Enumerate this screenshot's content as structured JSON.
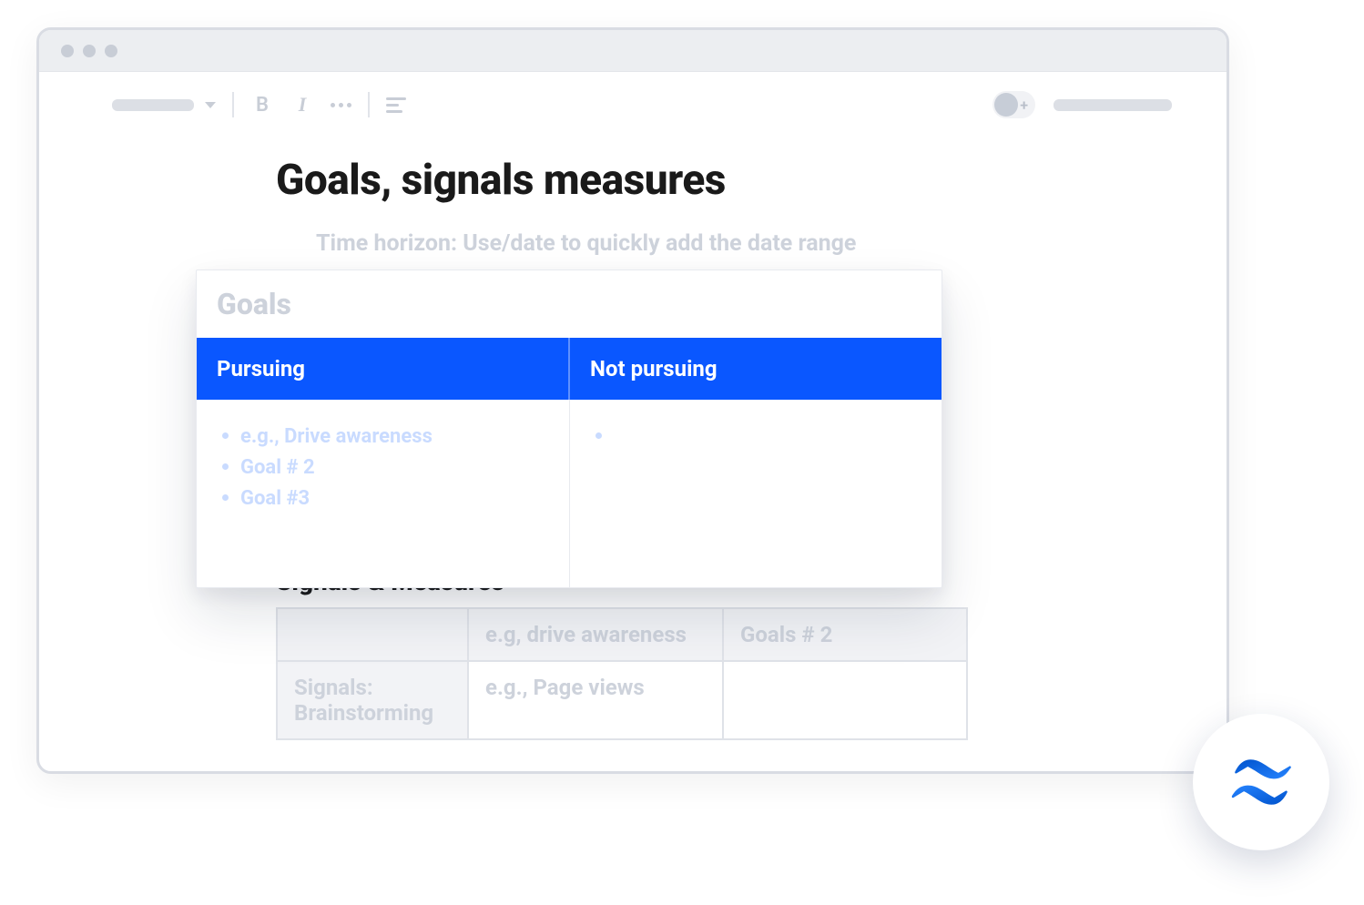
{
  "page": {
    "title": "Goals, signals measures",
    "subtitle": "Time horizon: Use/date to quickly add the date range"
  },
  "toolbar": {
    "bold_label": "B",
    "italic_label": "I"
  },
  "goals_card": {
    "heading": "Goals",
    "col_pursuing": "Pursuing",
    "col_not_pursuing": "Not pursuing",
    "pursuing_items": [
      "e.g., Drive awareness",
      "Goal # 2",
      "Goal #3"
    ]
  },
  "signals_section": {
    "heading": "Signals & Measures",
    "col1": "e.g, drive awareness",
    "col2": "Goals # 2",
    "row1_label": "Signals: Brainstorming",
    "row1_col1": "e.g., Page views"
  }
}
